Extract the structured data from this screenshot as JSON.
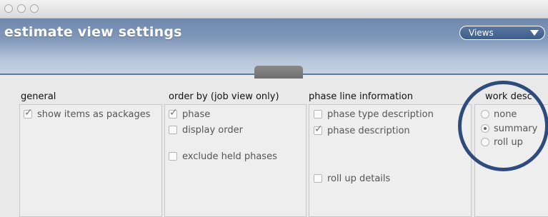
{
  "window": {
    "title": "estimate view settings",
    "views_label": "Views"
  },
  "columns": {
    "general": {
      "title": "general",
      "options": [
        {
          "label": "show items as packages",
          "checked": true
        }
      ]
    },
    "order_by": {
      "title": "order by (job view only)",
      "options": [
        {
          "label": "phase",
          "checked": true
        },
        {
          "label": "display order",
          "checked": false
        },
        {
          "label": "exclude held phases",
          "checked": false
        }
      ]
    },
    "phase_line": {
      "title": "phase line information",
      "options": [
        {
          "label": "phase type description",
          "checked": false
        },
        {
          "label": "phase description",
          "checked": true
        },
        {
          "label": "roll up details",
          "checked": false
        }
      ]
    },
    "work_desc": {
      "title": "work desc",
      "options": [
        {
          "label": "none",
          "selected": false
        },
        {
          "label": "summary",
          "selected": true
        },
        {
          "label": "roll up",
          "selected": false
        }
      ]
    }
  },
  "colors": {
    "header": "#7f97b9",
    "highlight_circle": "#2f4a7d"
  }
}
